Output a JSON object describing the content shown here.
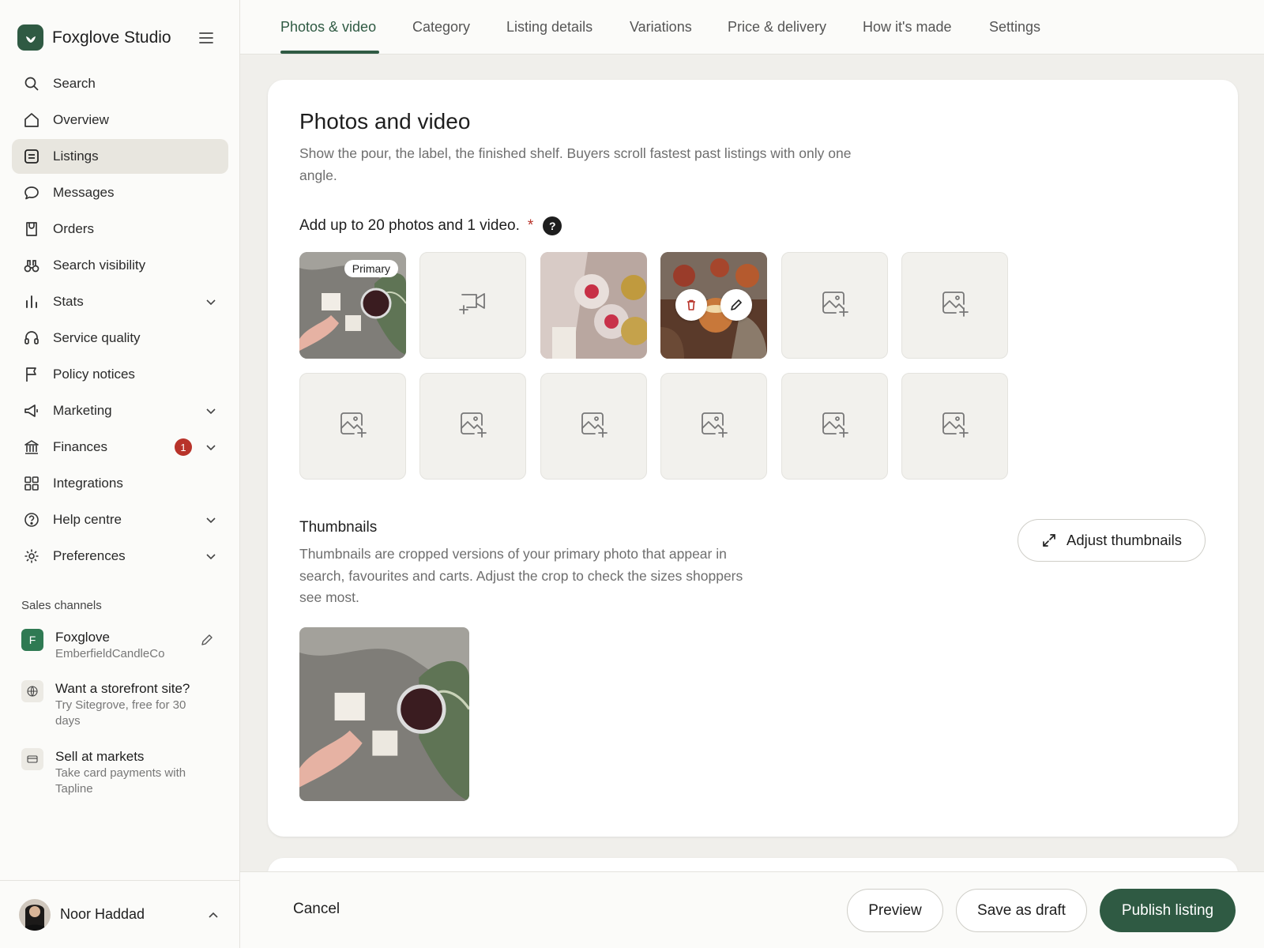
{
  "colors": {
    "accent": "#2f5a43",
    "badge": "#b8332a",
    "required": "#b8332a"
  },
  "brand": {
    "name": "Foxglove Studio",
    "icon": "leaf-logo-icon"
  },
  "sidebar": {
    "items": [
      {
        "label": "Search",
        "icon": "search-icon"
      },
      {
        "label": "Overview",
        "icon": "home-icon"
      },
      {
        "label": "Listings",
        "icon": "listings-icon",
        "active": true
      },
      {
        "label": "Messages",
        "icon": "message-icon"
      },
      {
        "label": "Orders",
        "icon": "bag-icon"
      },
      {
        "label": "Search visibility",
        "icon": "binoculars-icon"
      },
      {
        "label": "Stats",
        "icon": "bar-chart-icon",
        "expandable": true
      },
      {
        "label": "Service quality",
        "icon": "headset-icon"
      },
      {
        "label": "Policy notices",
        "icon": "flag-icon"
      },
      {
        "label": "Marketing",
        "icon": "megaphone-icon",
        "expandable": true
      },
      {
        "label": "Finances",
        "icon": "bank-icon",
        "expandable": true,
        "badge": "1"
      },
      {
        "label": "Integrations",
        "icon": "grid-icon"
      },
      {
        "label": "Help centre",
        "icon": "help-icon",
        "expandable": true
      },
      {
        "label": "Preferences",
        "icon": "gear-icon",
        "expandable": true
      }
    ],
    "sales_channels_title": "Sales channels",
    "channels": [
      {
        "title": "Foxglove",
        "subtitle": "EmberfieldCandleCo",
        "letter": "F"
      },
      {
        "title": "Want a storefront site?",
        "subtitle": "Try Sitegrove, free for 30 days"
      },
      {
        "title": "Sell at markets",
        "subtitle": "Take card payments with Tapline"
      }
    ],
    "user": {
      "name": "Noor Haddad"
    }
  },
  "tabs": [
    "Photos & video",
    "Category",
    "Listing details",
    "Variations",
    "Price & delivery",
    "How it's made",
    "Settings"
  ],
  "photos": {
    "title": "Photos and video",
    "description": "Show the pour, the label, the finished shelf. Buyers scroll fastest past listings with only one angle.",
    "add_label": "Add up to 20 photos and 1 video.",
    "required_mark": "*",
    "help": "?",
    "primary_label": "Primary",
    "tiles_row1": [
      "photo-primary",
      "add-video",
      "photo",
      "photo-hover",
      "add-photo",
      "add-photo"
    ],
    "tiles_row2": [
      "add-photo",
      "add-photo",
      "add-photo",
      "add-photo",
      "add-photo",
      "add-photo"
    ]
  },
  "thumbnails": {
    "title": "Thumbnails",
    "description": "Thumbnails are cropped versions of your primary photo that appear in search, favourites and carts. Adjust the crop to check the sizes shoppers see most.",
    "adjust_label": "Adjust thumbnails"
  },
  "footer": {
    "cancel": "Cancel",
    "preview": "Preview",
    "save_draft": "Save as draft",
    "publish": "Publish listing"
  }
}
